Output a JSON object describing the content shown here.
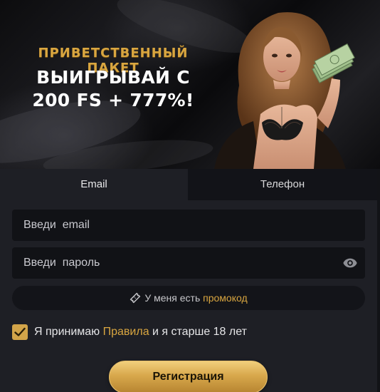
{
  "banner": {
    "label": "ПРИВЕТСТВЕННЫЙ ПАКЕТ",
    "line1": "ВЫИГРЫВАЙ С",
    "line2": "200 FS + 777%!"
  },
  "tabs": [
    {
      "label": "Email",
      "active": true
    },
    {
      "label": "Телефон",
      "active": false
    }
  ],
  "form": {
    "email_placeholder": "Введи  email",
    "password_placeholder": "Введи  пароль",
    "promo_prefix": "У меня есть ",
    "promo_link": "промокод",
    "agree_prefix": "Я принимаю ",
    "agree_link": "Правила",
    "agree_suffix": " и я старше 18 лет",
    "agree_checked": true,
    "submit_label": "Регистрация"
  },
  "icons": {
    "password_toggle": "eye-icon",
    "promo": "ticket-icon",
    "checkbox": "check-icon"
  },
  "colors": {
    "accent_gold": "#d9a640",
    "background": "#1e1f25",
    "field": "#111216"
  }
}
